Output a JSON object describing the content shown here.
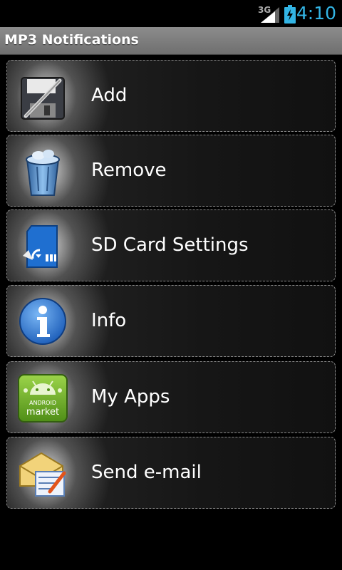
{
  "status_bar": {
    "network": "3G",
    "time": "4:10",
    "colors": {
      "time": "#33b5e5",
      "battery": "#33b5e5"
    }
  },
  "app": {
    "title": "MP3 Notifications"
  },
  "menu": [
    {
      "label": "Add",
      "icon": "floppy-pen-icon"
    },
    {
      "label": "Remove",
      "icon": "trash-can-icon"
    },
    {
      "label": "SD Card Settings",
      "icon": "sd-card-icon"
    },
    {
      "label": "Info",
      "icon": "info-icon"
    },
    {
      "label": "My Apps",
      "icon": "android-market-icon"
    },
    {
      "label": "Send e-mail",
      "icon": "mail-icon"
    }
  ]
}
